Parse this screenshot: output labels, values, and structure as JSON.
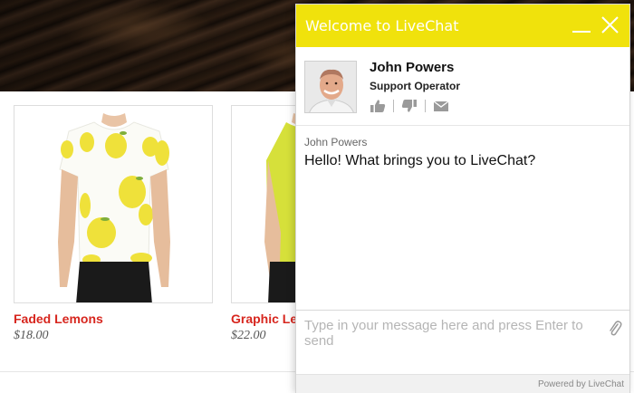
{
  "store": {
    "products": [
      {
        "name": "Faded Lemons",
        "price": "$18.00"
      },
      {
        "name": "Graphic Le",
        "price": "$22.00"
      }
    ]
  },
  "chat": {
    "title": "Welcome to LiveChat",
    "accent_color": "#f0e20c",
    "agent": {
      "name": "John Powers",
      "role": "Support Operator"
    },
    "messages": [
      {
        "author": "John Powers",
        "text": "Hello! What brings you to LiveChat?"
      }
    ],
    "composer": {
      "placeholder": "Type in your message here and press Enter to send"
    },
    "footer": "Powered by LiveChat"
  }
}
